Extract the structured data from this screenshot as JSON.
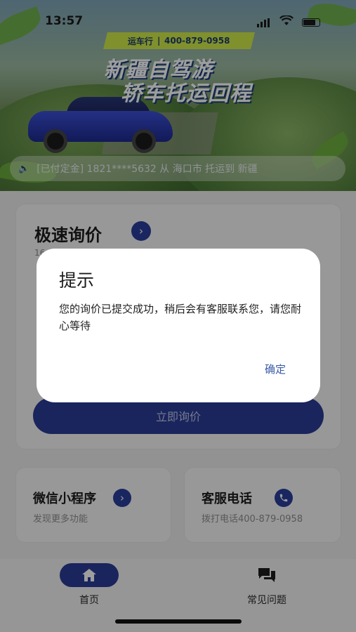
{
  "status": {
    "time": "13:57"
  },
  "banner": {
    "brand": "运车行",
    "phone": "400-879-0958",
    "slogan_line1": "新疆自驾游",
    "slogan_line2": "轿车托运回程",
    "ticker": "[已付定金] 1821****5632 从 海口市 托运到 新疆"
  },
  "quote": {
    "title": "极速询价",
    "subtitle": "16",
    "submit_label": "立即询价"
  },
  "cards": {
    "mini_program": {
      "title": "微信小程序",
      "subtitle": "发现更多功能"
    },
    "service_phone": {
      "title": "客服电话",
      "subtitle": "拨打电话400-879-0958"
    }
  },
  "tabbar": {
    "home": "首页",
    "faq": "常见问题"
  },
  "dialog": {
    "title": "提示",
    "message": "您的询价已提交成功，稍后会有客服联系您，请您耐心等待",
    "ok_label": "确定"
  },
  "colors": {
    "primary": "#2b3c96",
    "dialog_link": "#3a59a8"
  }
}
